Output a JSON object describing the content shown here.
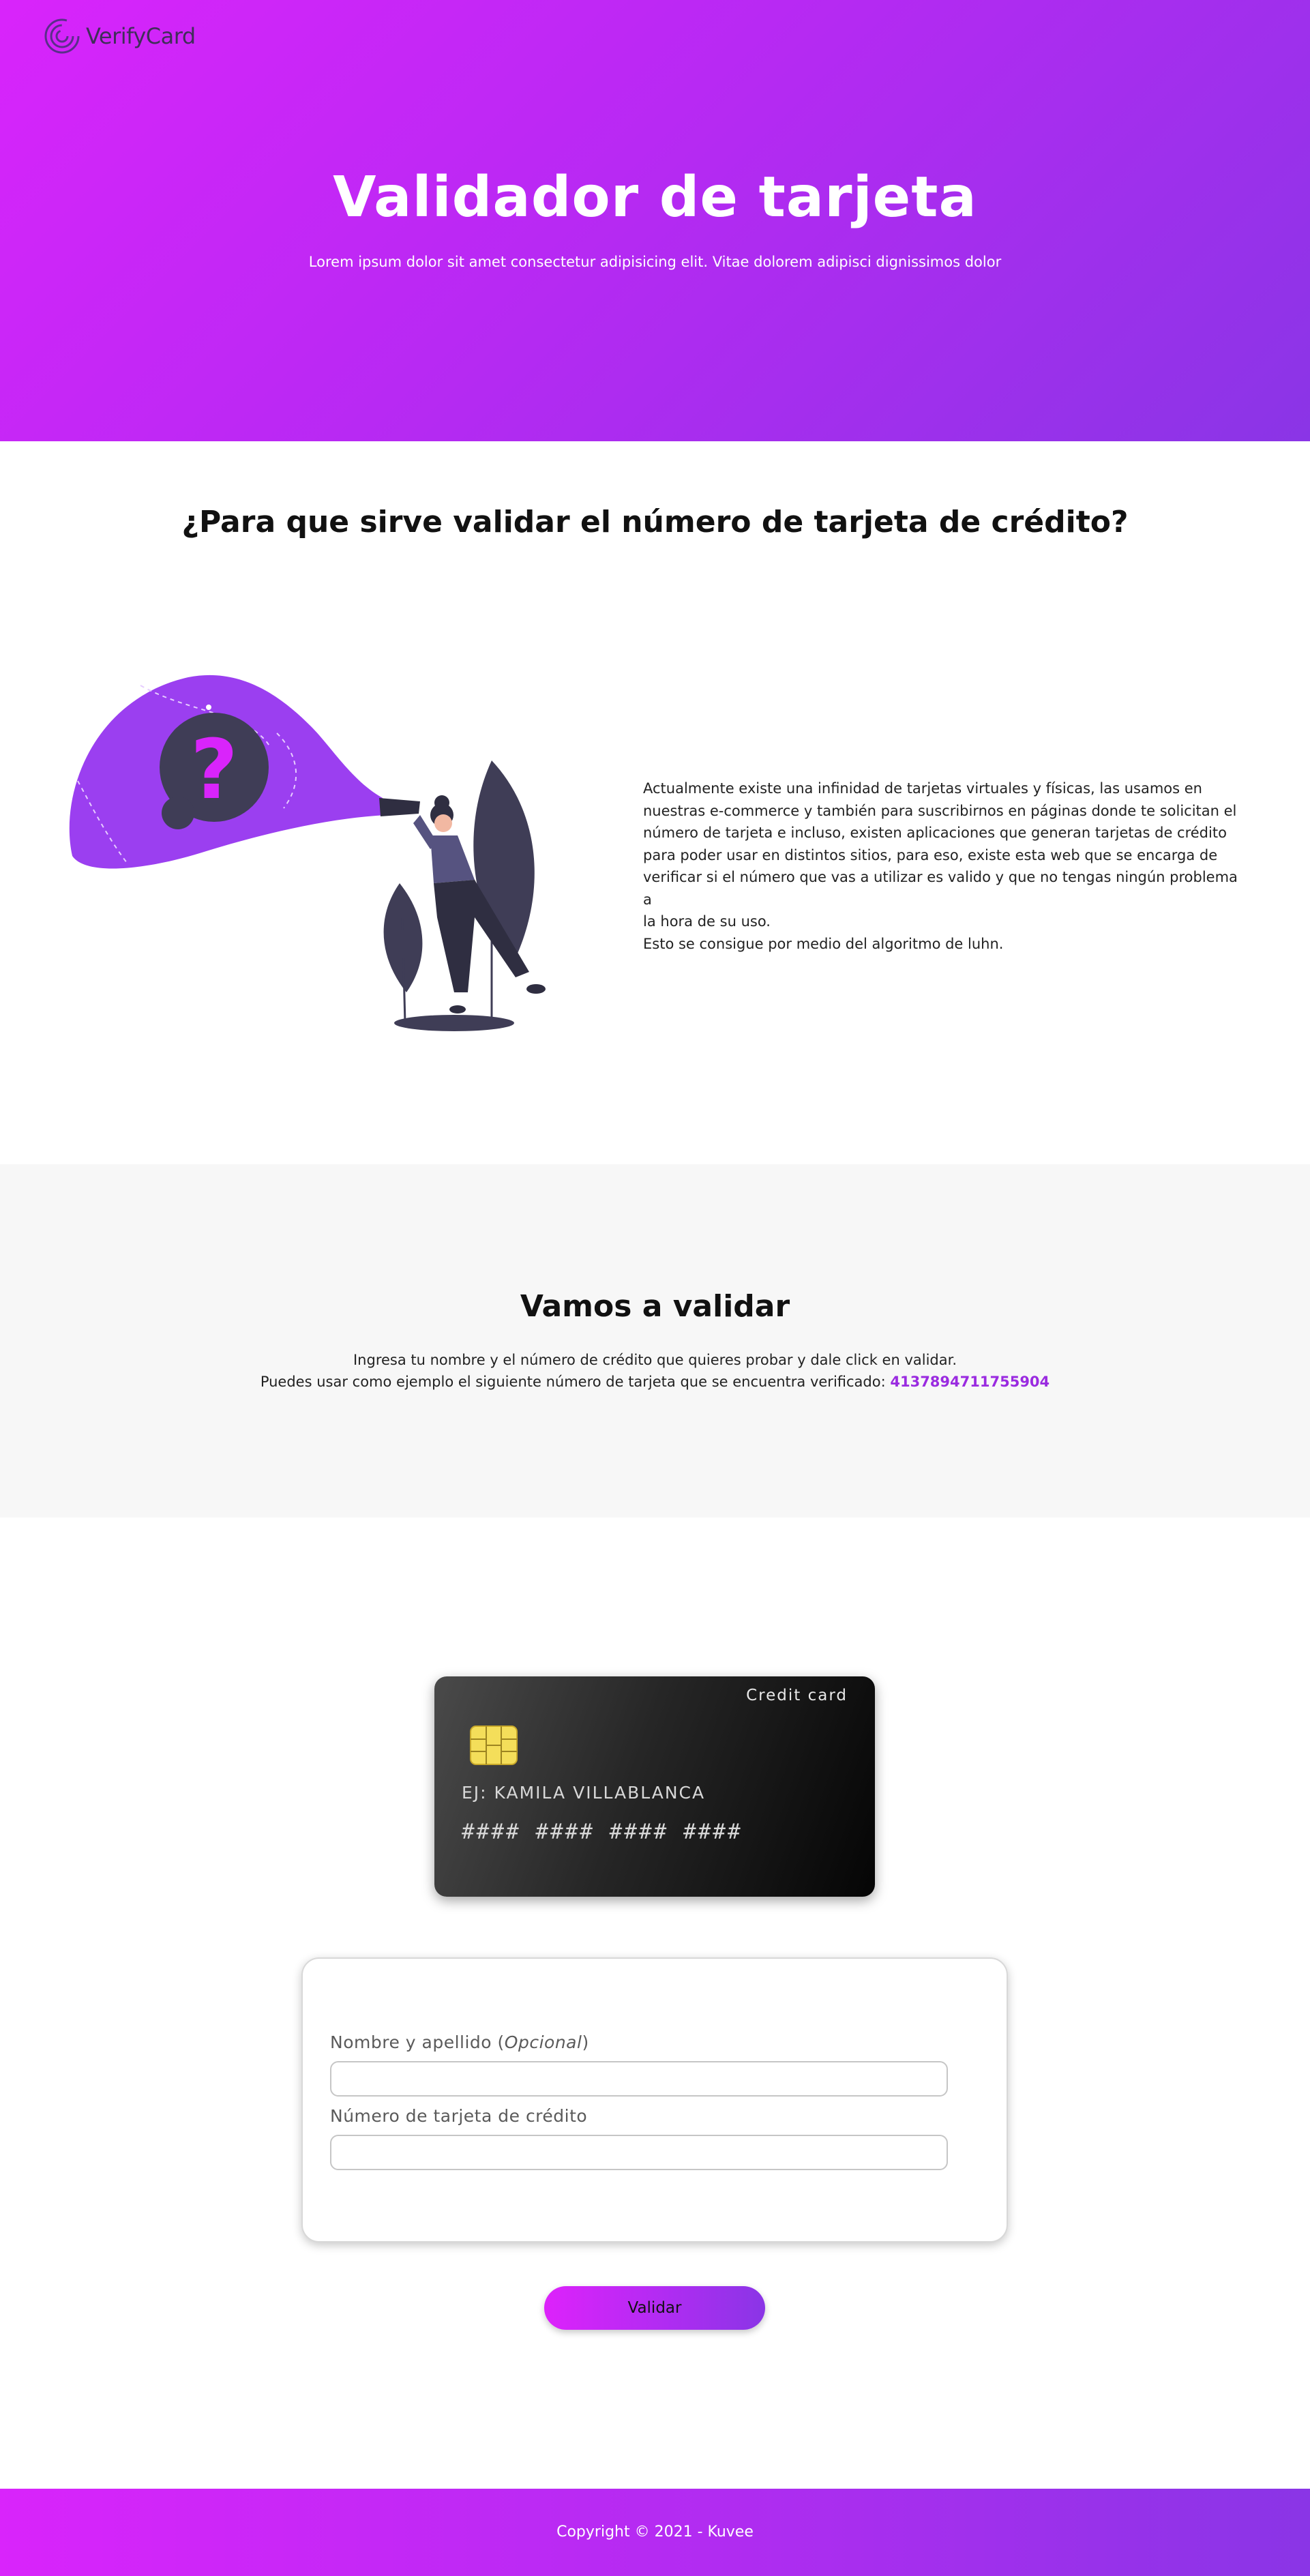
{
  "header": {
    "logo_text": "VerifyCard",
    "logo_icon": "spiral-logo-icon"
  },
  "hero": {
    "title": "Validador de tarjeta",
    "subtitle": "Lorem ipsum dolor sit amet consectetur adipisicing elit. Vitae dolorem adipisci dignissimos dolor"
  },
  "why": {
    "title": "¿Para que sirve validar el número de tarjeta de crédito?",
    "illustration": "woman-flashlight-question-illustration",
    "paragraph_lines": [
      "Actualmente existe una infinidad de tarjetas virtuales y físicas, las usamos en",
      "nuestras e-commerce y también para suscribirnos en páginas donde te solicitan el",
      "número de tarjeta e incluso, existen aplicaciones que generan tarjetas de crédito",
      "para poder usar en distintos sitios, para eso, existe esta web que se encarga de",
      "verificar si el número que vas a utilizar es valido y que no tengas ningún problema a",
      "la hora de su uso.",
      "Esto se consigue por medio del algoritmo de luhn."
    ]
  },
  "validate": {
    "title": "Vamos a validar",
    "instruction": "Ingresa tu nombre y el número de crédito que quieres probar y dale click en validar.",
    "example_prefix": "Puedes usar como ejemplo el siguiente número de tarjeta que se encuentra verificado: ",
    "example_number": "4137894711755904"
  },
  "card": {
    "type_label": "Credit card",
    "chip_icon": "card-chip-icon",
    "name_placeholder": "EJ: KAMILA VILLABLANCA",
    "number_placeholder": "#### #### #### ####"
  },
  "form": {
    "name_label": "Nombre y apellido (",
    "name_label_optional": "Opcional",
    "name_label_close": ")",
    "name_value": "",
    "card_label": "Número de tarjeta de crédito",
    "card_value": "",
    "submit_label": "Validar"
  },
  "footer": {
    "copyright": "Copyright © 2021 - Kuvee"
  },
  "colors": {
    "accent_pink": "#d924fb",
    "accent_purple": "#8a35e6",
    "link_purple": "#9a2be0",
    "card_dark": "#050505"
  }
}
